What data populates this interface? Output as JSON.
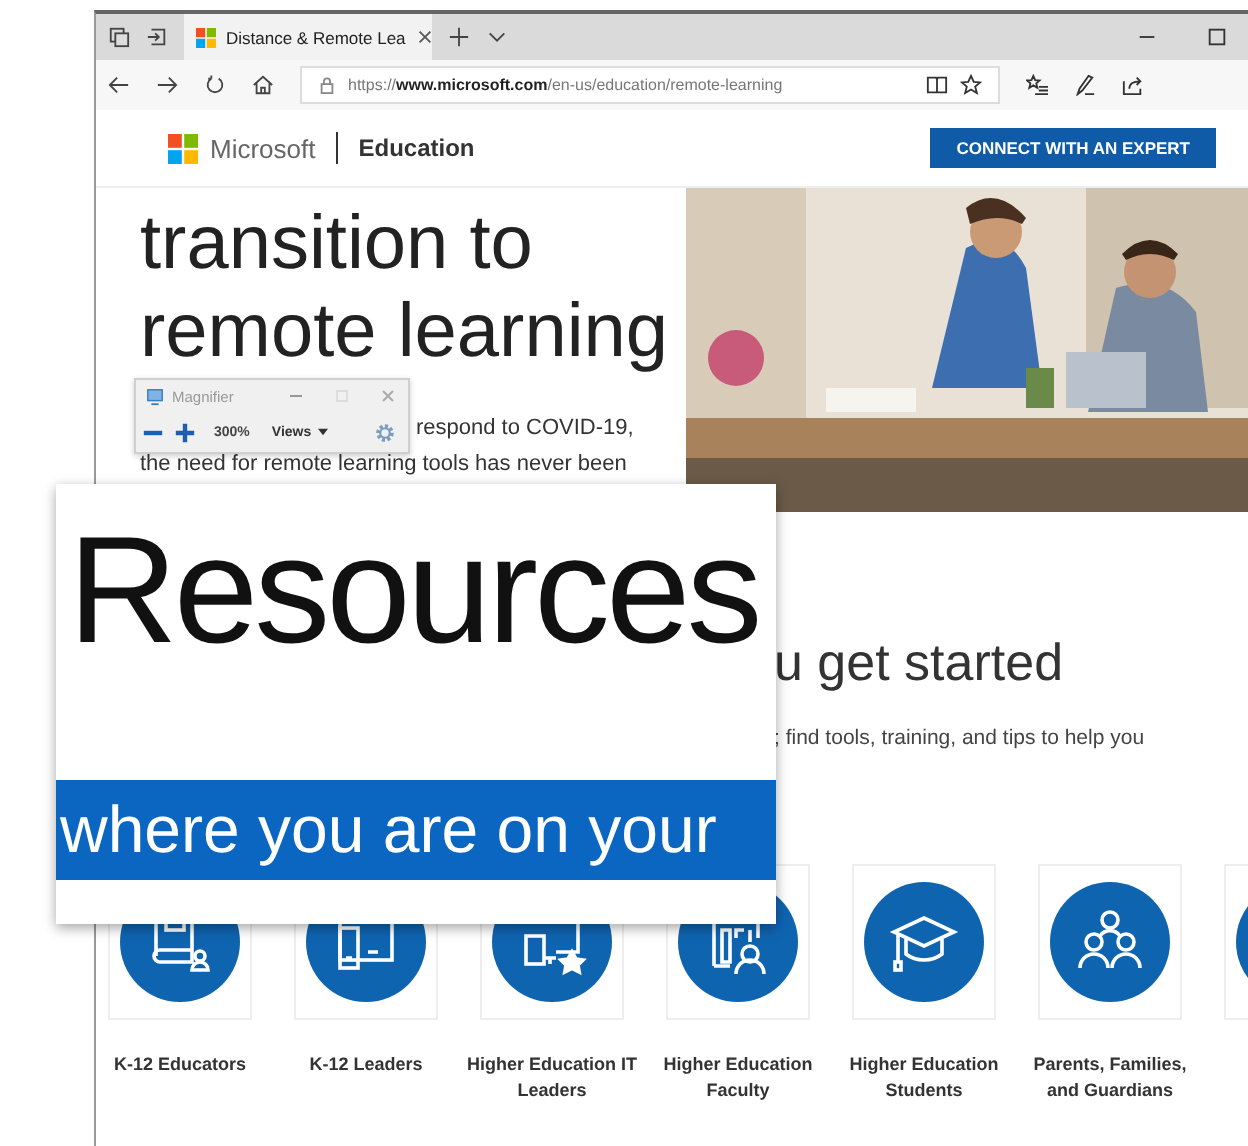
{
  "browser": {
    "tabs": [
      {
        "title": "Distance & Remote Lea",
        "selected": true
      }
    ],
    "address": {
      "scheme": "https://",
      "domain": "www.microsoft.com",
      "path": "/en-us/education/remote-learning"
    }
  },
  "site_header": {
    "brand": "Microsoft",
    "section": "Education",
    "cta": "CONNECT WITH AN EXPERT"
  },
  "hero": {
    "heading_lines": [
      "transition to",
      "remote learning"
    ],
    "paragraph_lines": [
      "respond to COVID-19,",
      "the need for remote learning tools has never been"
    ]
  },
  "magnifier": {
    "title": "Magnifier",
    "zoom": "300%",
    "views": "Views"
  },
  "lens": {
    "large_text": "Resources",
    "highlighted_text": "where you are on your"
  },
  "resources": {
    "heading": "u get started",
    "subtitle": "; find tools, training, and tips to help you"
  },
  "cards": [
    {
      "label": "K-12 Educators"
    },
    {
      "label": "K-12 Leaders"
    },
    {
      "label": "Higher Education IT Leaders"
    },
    {
      "label": "Higher Education Faculty"
    },
    {
      "label": "Higher Education Students"
    },
    {
      "label": "Parents, Families, and Guardians"
    }
  ]
}
